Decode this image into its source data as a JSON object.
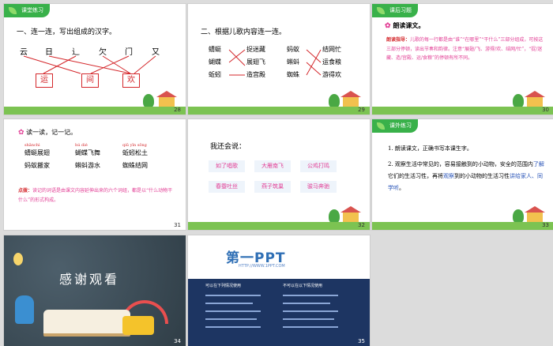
{
  "slides": [
    {
      "number": "28",
      "tag": "课堂练习",
      "heading": "一、连一连，写出组成的汉字。",
      "top_chars": [
        "云",
        "日",
        "辶",
        "欠",
        "门",
        "又"
      ],
      "answers": [
        "运",
        "间",
        "欢"
      ]
    },
    {
      "number": "29",
      "heading": "二、根据儿歌内容连一连。",
      "left_words": [
        "蜻蜓",
        "蝴蝶",
        "蚯蚓"
      ],
      "mid_words": [
        "捉迷藏",
        "展翅飞",
        "造宫殿"
      ],
      "insect_words": [
        "蚂蚁",
        "蝌蚪",
        "蜘蛛"
      ],
      "right_words": [
        "结网忙",
        "运食粮",
        "游得欢"
      ]
    },
    {
      "number": "30",
      "tag": "课后习题",
      "title": "朗读课文。",
      "guide_label": "朗读指导：",
      "guide_text": "儿歌的每一行都是由“谁”“在哪里”“干什么”三部分组成，可按这三部分停顿，读出节奏和韵律。注意“展翅/飞、游得/欢、结网/忙”，“捉/迷藏、造/宫殿、运/食粮”的停顿有所不同。"
    },
    {
      "number": "31",
      "title": "读一读，记一记。",
      "columns": [
        {
          "pinyin": "shǎnchì",
          "words": [
            "蜻蜓展翅",
            "蚂蚁搬家"
          ]
        },
        {
          "pinyin": "hú dié",
          "words": [
            "蝴蝶飞舞",
            "蝌蚪游水"
          ]
        },
        {
          "pinyin": "qiū yǐn sōng",
          "words": [
            "蚯蚓松土",
            "蜘蛛结网"
          ]
        }
      ],
      "note_label": "点拨：",
      "note_text": "读记的词语是由课文内容延伸出来的六个词组，都是以“什么动物干什么”的形式构成。"
    },
    {
      "number": "32",
      "title": "我还会说：",
      "cards": [
        "如了唱歌",
        "大雁南飞",
        "公鸡打鸣",
        "春蚕吐丝",
        "燕子筑巢",
        "骏马奔驰"
      ]
    },
    {
      "number": "33",
      "tag": "课外练习",
      "item1": "1. 朗读课文，正确书写本课生字。",
      "item2_start": "2. 观察生活中常见的，容易接触到的小动物，安全的范围内",
      "item2_learn": "了解",
      "item2_mid": "它们的生活习性，再将",
      "item2_obs": "观察",
      "item2_end": "到的小动物的生活习性",
      "item2_tell": "讲给家人、同学听",
      "item2_stop": "。"
    },
    {
      "number": "34",
      "thanks": "感谢观看"
    },
    {
      "number": "35",
      "logo": "第一PPT",
      "url": "HTTP://WWW.1PPT.COM",
      "col_left": "可以在下列情况使用",
      "col_right": "不可以在以下情况使用"
    }
  ]
}
